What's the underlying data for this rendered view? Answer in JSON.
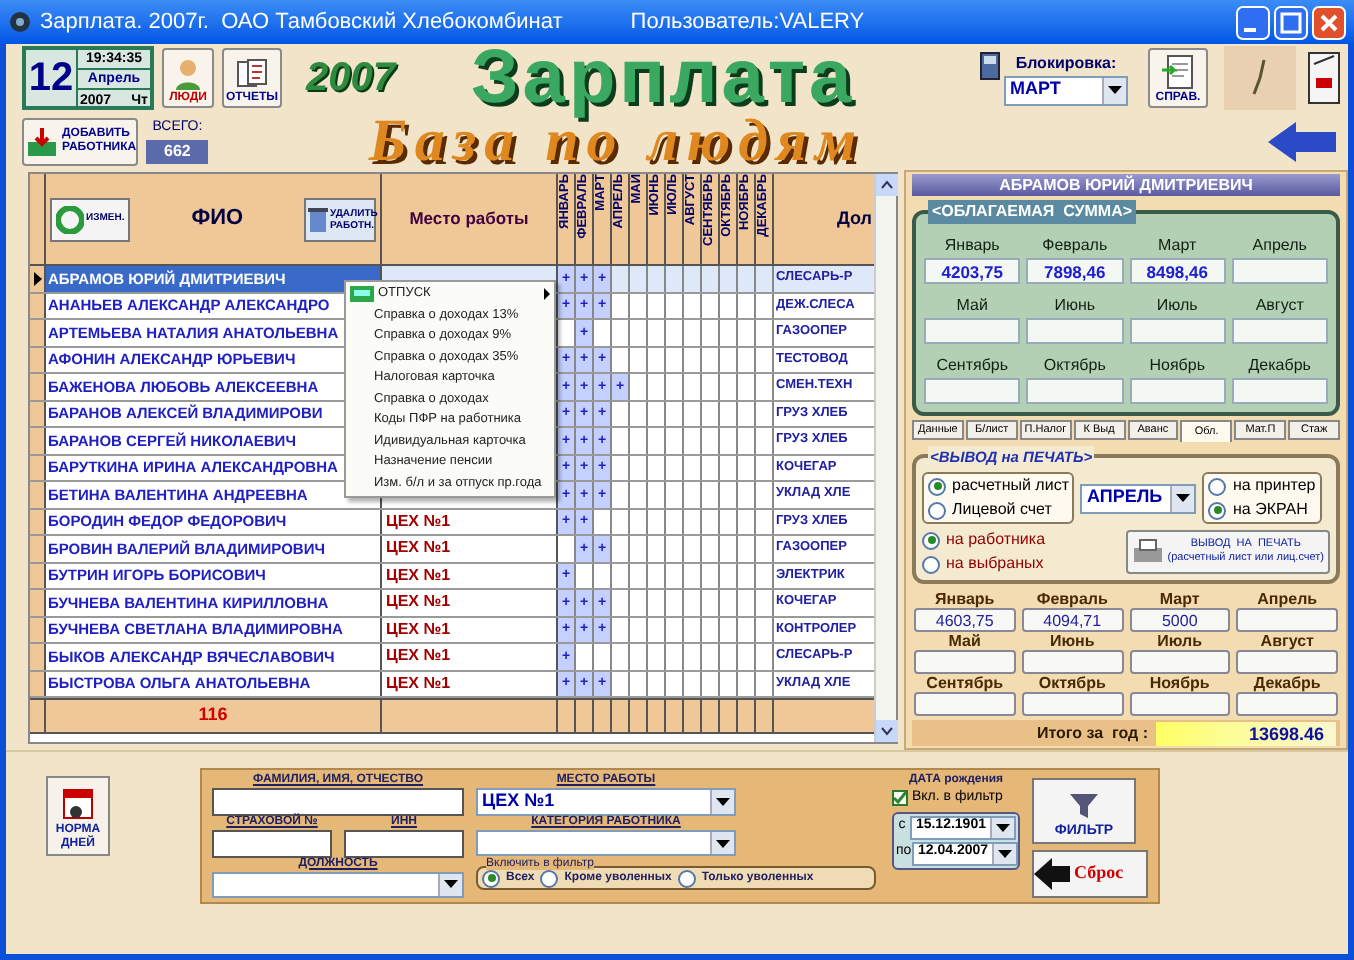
{
  "window": {
    "title": "Зарплата. 2007г.  ОАО Тамбовский Хлебокомбинат",
    "user": "Пользователь:VALERY"
  },
  "toolbar": {
    "date": {
      "day": "12",
      "time": "19:34:35",
      "month": "Апрель",
      "year": "2007",
      "weekday": "Чт"
    },
    "people_button": "ЛЮДИ",
    "reports_button": "ОТЧЕТЫ",
    "year": "2007",
    "title": "Зарплата",
    "subtitle": "База по людям",
    "lock": {
      "label": "Блокировка:",
      "value": "МАРТ"
    },
    "reference_button": "СПРАВ.",
    "add_button": "ДОБАВИТЬ РАБОТНИКА",
    "total": {
      "label": "ВСЕГО:",
      "value": "662"
    }
  },
  "table": {
    "edit_button": "ИЗМЕН.",
    "fio_header": "ФИО",
    "delete_button": "УДАЛИТЬ РАБОТН.",
    "place_header": "Место работы",
    "months": [
      "ЯНВАРЬ",
      "ФЕВРАЛЬ",
      "МАРТ",
      "АПРЕЛЬ",
      "МАЙ",
      "ИЮНЬ",
      "ИЮЛЬ",
      "АВГУСТ",
      "СЕНТЯБРЬ",
      "ОКТЯБРЬ",
      "НОЯБРЬ",
      "ДЕКАБРЬ"
    ],
    "position_header": "Дол",
    "rows": [
      {
        "name": "АБРАМОВ ЮРИЙ ДМИТРИЕВИЧ",
        "months": [
          {
            "checked": true,
            "mark": "+"
          },
          {
            "checked": true,
            "mark": "+"
          },
          {
            "checked": true,
            "mark": "+"
          },
          {
            "checked": false
          },
          {
            "checked": false
          },
          {
            "checked": false
          },
          {
            "checked": false
          },
          {
            "checked": false
          },
          {
            "checked": false
          },
          {
            "checked": false
          },
          {
            "checked": false
          },
          {
            "checked": false
          }
        ],
        "position": "СЛЕСАРЬ-Р",
        "selected": true
      },
      {
        "name": "АНАНЬЕВ АЛЕКСАНДР АЛЕКСАНДРО",
        "months": [
          {
            "checked": true,
            "mark": "+"
          },
          {
            "checked": true,
            "mark": "+"
          },
          {
            "checked": true,
            "mark": "+"
          },
          {
            "checked": false
          },
          {
            "checked": false
          },
          {
            "checked": false
          },
          {
            "checked": false
          },
          {
            "checked": false
          },
          {
            "checked": false
          },
          {
            "checked": false
          },
          {
            "checked": false
          },
          {
            "checked": false
          }
        ],
        "position": "ДЕЖ.СЛЕСА",
        "selected": false
      },
      {
        "name": "АРТЕМЬЕВА НАТАЛИЯ АНАТОЛЬЕВНА",
        "months": [
          {
            "checked": false
          },
          {
            "checked": true,
            "mark": "+"
          },
          {
            "checked": false
          },
          {
            "checked": false
          },
          {
            "checked": false
          },
          {
            "checked": false
          },
          {
            "checked": false
          },
          {
            "checked": false
          },
          {
            "checked": false
          },
          {
            "checked": false
          },
          {
            "checked": false
          },
          {
            "checked": false
          }
        ],
        "position": "ГАЗООПЕР",
        "selected": false
      },
      {
        "name": "АФОНИН АЛЕКСАНДР ЮРЬЕВИЧ",
        "months": [
          {
            "checked": true,
            "mark": "+"
          },
          {
            "checked": true,
            "mark": "+"
          },
          {
            "checked": true,
            "mark": "+"
          },
          {
            "checked": false
          },
          {
            "checked": false
          },
          {
            "checked": false
          },
          {
            "checked": false
          },
          {
            "checked": false
          },
          {
            "checked": false
          },
          {
            "checked": false
          },
          {
            "checked": false
          },
          {
            "checked": false
          }
        ],
        "position": "ТЕСТОВОД",
        "selected": false
      },
      {
        "name": "БАЖЕНОВА ЛЮБОВЬ АЛЕКСЕЕВНА",
        "months": [
          {
            "checked": true,
            "mark": "+"
          },
          {
            "checked": true,
            "mark": "+"
          },
          {
            "checked": true,
            "mark": "+"
          },
          {
            "checked": true,
            "mark": "+"
          },
          {
            "checked": false
          },
          {
            "checked": false
          },
          {
            "checked": false
          },
          {
            "checked": false
          },
          {
            "checked": false
          },
          {
            "checked": false
          },
          {
            "checked": false
          },
          {
            "checked": false
          }
        ],
        "position": "СМЕН.ТЕХН",
        "selected": false
      },
      {
        "name": "БАРАНОВ АЛЕКСЕЙ ВЛАДИМИРОВИ",
        "months": [
          {
            "checked": true,
            "mark": "+"
          },
          {
            "checked": true,
            "mark": "+"
          },
          {
            "checked": true,
            "mark": "+"
          },
          {
            "checked": false
          },
          {
            "checked": false
          },
          {
            "checked": false
          },
          {
            "checked": false
          },
          {
            "checked": false
          },
          {
            "checked": false
          },
          {
            "checked": false
          },
          {
            "checked": false
          },
          {
            "checked": false
          }
        ],
        "position": "ГРУЗ ХЛЕБ",
        "selected": false
      },
      {
        "name": "БАРАНОВ СЕРГЕЙ НИКОЛАЕВИЧ",
        "months": [
          {
            "checked": true,
            "mark": "+"
          },
          {
            "checked": true,
            "mark": "+"
          },
          {
            "checked": true,
            "mark": "+"
          },
          {
            "checked": false
          },
          {
            "checked": false
          },
          {
            "checked": false
          },
          {
            "checked": false
          },
          {
            "checked": false
          },
          {
            "checked": false
          },
          {
            "checked": false
          },
          {
            "checked": false
          },
          {
            "checked": false
          }
        ],
        "position": "ГРУЗ ХЛЕБ",
        "selected": false
      },
      {
        "name": "БАРУТКИНА ИРИНА АЛЕКСАНДРОВНА",
        "months": [
          {
            "checked": true,
            "mark": "+"
          },
          {
            "checked": true,
            "mark": "+"
          },
          {
            "checked": true,
            "mark": "+"
          },
          {
            "checked": false
          },
          {
            "checked": false
          },
          {
            "checked": false
          },
          {
            "checked": false
          },
          {
            "checked": false
          },
          {
            "checked": false
          },
          {
            "checked": false
          },
          {
            "checked": false
          },
          {
            "checked": false
          }
        ],
        "position": "КОЧЕГАР",
        "selected": false
      },
      {
        "name": "БЕТИНА ВАЛЕНТИНА АНДРЕЕВНА",
        "months": [
          {
            "checked": true,
            "mark": "+"
          },
          {
            "checked": true,
            "mark": "+"
          },
          {
            "checked": true,
            "mark": "+"
          },
          {
            "checked": false
          },
          {
            "checked": false
          },
          {
            "checked": false
          },
          {
            "checked": false
          },
          {
            "checked": false
          },
          {
            "checked": false
          },
          {
            "checked": false
          },
          {
            "checked": false
          },
          {
            "checked": false
          }
        ],
        "position": "УКЛАД ХЛЕ",
        "selected": false
      },
      {
        "name": "БОРОДИН ФЕДОР ФЕДОРОВИЧ",
        "place": "ЦЕХ №1",
        "months": [
          {
            "checked": true,
            "mark": "+"
          },
          {
            "checked": true,
            "mark": "+"
          },
          {
            "checked": false
          },
          {
            "checked": false
          },
          {
            "checked": false
          },
          {
            "checked": false
          },
          {
            "checked": false
          },
          {
            "checked": false
          },
          {
            "checked": false
          },
          {
            "checked": false
          },
          {
            "checked": false
          },
          {
            "checked": false
          }
        ],
        "position": "ГРУЗ ХЛЕБ",
        "selected": false
      },
      {
        "name": "БРОВИН ВАЛЕРИЙ ВЛАДИМИРОВИЧ",
        "place": "ЦЕХ №1",
        "months": [
          {
            "checked": false
          },
          {
            "checked": true,
            "mark": "+"
          },
          {
            "checked": true,
            "mark": "+"
          },
          {
            "checked": false
          },
          {
            "checked": false
          },
          {
            "checked": false
          },
          {
            "checked": false
          },
          {
            "checked": false
          },
          {
            "checked": false
          },
          {
            "checked": false
          },
          {
            "checked": false
          },
          {
            "checked": false
          }
        ],
        "position": "ГАЗООПЕР",
        "selected": false
      },
      {
        "name": "БУТРИН ИГОРЬ БОРИСОВИЧ",
        "place": "ЦЕХ №1",
        "months": [
          {
            "checked": true,
            "mark": "+"
          },
          {
            "checked": false
          },
          {
            "checked": false
          },
          {
            "checked": false
          },
          {
            "checked": false
          },
          {
            "checked": false
          },
          {
            "checked": false
          },
          {
            "checked": false
          },
          {
            "checked": false
          },
          {
            "checked": false
          },
          {
            "checked": false
          },
          {
            "checked": false
          }
        ],
        "position": "ЭЛЕКТРИК",
        "selected": false
      },
      {
        "name": "БУЧНЕВА ВАЛЕНТИНА КИРИЛЛОВНА",
        "place": "ЦЕХ №1",
        "months": [
          {
            "checked": true,
            "mark": "+"
          },
          {
            "checked": true,
            "mark": "+"
          },
          {
            "checked": true,
            "mark": "+"
          },
          {
            "checked": false
          },
          {
            "checked": false
          },
          {
            "checked": false
          },
          {
            "checked": false
          },
          {
            "checked": false
          },
          {
            "checked": false
          },
          {
            "checked": false
          },
          {
            "checked": false
          },
          {
            "checked": false
          }
        ],
        "position": "КОЧЕГАР",
        "selected": false
      },
      {
        "name": "БУЧНЕВА СВЕТЛАНА ВЛАДИМИРОВНА",
        "place": "ЦЕХ №1",
        "months": [
          {
            "checked": true,
            "mark": "+"
          },
          {
            "checked": true,
            "mark": "+"
          },
          {
            "checked": true,
            "mark": "+"
          },
          {
            "checked": false
          },
          {
            "checked": false
          },
          {
            "checked": false
          },
          {
            "checked": false
          },
          {
            "checked": false
          },
          {
            "checked": false
          },
          {
            "checked": false
          },
          {
            "checked": false
          },
          {
            "checked": false
          }
        ],
        "position": "КОНТРОЛЕР",
        "selected": false
      },
      {
        "name": "БЫКОВ АЛЕКСАНДР ВЯЧЕСЛАВОВИЧ",
        "place": "ЦЕХ №1",
        "months": [
          {
            "checked": true,
            "mark": "+"
          },
          {
            "checked": false
          },
          {
            "checked": false
          },
          {
            "checked": false
          },
          {
            "checked": false
          },
          {
            "checked": false
          },
          {
            "checked": false
          },
          {
            "checked": false
          },
          {
            "checked": false
          },
          {
            "checked": false
          },
          {
            "checked": false
          },
          {
            "checked": false
          }
        ],
        "position": "СЛЕСАРЬ-Р",
        "selected": false
      },
      {
        "name": "БЫСТРОВА ОЛЬГА АНАТОЛЬЕВНА",
        "place": "ЦЕХ №1",
        "months": [
          {
            "checked": true,
            "mark": "+"
          },
          {
            "checked": true,
            "mark": "+"
          },
          {
            "checked": true,
            "mark": "+"
          },
          {
            "checked": false
          },
          {
            "checked": false
          },
          {
            "checked": false
          },
          {
            "checked": false
          },
          {
            "checked": false
          },
          {
            "checked": false
          },
          {
            "checked": false
          },
          {
            "checked": false
          },
          {
            "checked": false
          }
        ],
        "position": "УКЛАД ХЛЕ",
        "selected": false
      }
    ],
    "footer_count": "116"
  },
  "context_menu": [
    {
      "label": "ОТПУСК",
      "kind": "submenu"
    },
    {
      "label": "Справка о доходах 13%",
      "kind": "plain"
    },
    {
      "label": "Справка о доходах 9%",
      "kind": "plain"
    },
    {
      "label": "Справка о доходах 35%",
      "kind": "plain"
    },
    {
      "label": "Налоговая карточка",
      "kind": "plain"
    },
    {
      "label": "Справка о доходах",
      "kind": "plain"
    },
    {
      "label": "Коды ПФР на работника",
      "kind": "plain"
    },
    {
      "label": "Идивидуальная карточка",
      "kind": "plain"
    },
    {
      "label": "Назначение пенсии",
      "kind": "plain"
    },
    {
      "label": "Изм. б/л и за отпуск пр.года",
      "kind": "plain"
    }
  ],
  "employee": {
    "name": "АБРАМОВ ЮРИЙ ДМИТРИЕВИЧ",
    "taxable": {
      "title": "<ОБЛАГАЕМАЯ  СУММА>",
      "months": [
        {
          "label": "Январь",
          "value": "4203,75"
        },
        {
          "label": "Февраль",
          "value": "7898,46"
        },
        {
          "label": "Март",
          "value": "8498,46"
        },
        {
          "label": "Апрель"
        },
        {
          "label": "Май"
        },
        {
          "label": "Июнь"
        },
        {
          "label": "Июль"
        },
        {
          "label": "Август"
        },
        {
          "label": "Сентябрь"
        },
        {
          "label": "Октябрь"
        },
        {
          "label": "Ноябрь"
        },
        {
          "label": "Декабрь"
        }
      ]
    },
    "tabs": [
      {
        "label": "Данные",
        "selected": false
      },
      {
        "label": "Б/лист",
        "selected": false
      },
      {
        "label": "П.Налог",
        "selected": false
      },
      {
        "label": "К Выд",
        "selected": false
      },
      {
        "label": "Аванс",
        "selected": false
      },
      {
        "label": "Обл.",
        "selected": true
      },
      {
        "label": "Мат.П",
        "selected": false
      },
      {
        "label": "Стаж",
        "selected": false
      }
    ],
    "print": {
      "title": "<ВЫВОД на ПЕЧАТЬ>",
      "documents": [
        {
          "label": "расчетный лист",
          "selected": true
        },
        {
          "label": "Лицевой счет",
          "selected": false
        }
      ],
      "month": "АПРЕЛЬ",
      "outputs": [
        {
          "label": "на принтер",
          "selected": false
        },
        {
          "label": "на ЭКРАН",
          "selected": true
        }
      ],
      "targets": [
        {
          "label": "на работника",
          "selected": true
        },
        {
          "label": "на выбраных",
          "selected": false
        }
      ],
      "button": {
        "line1": "ВЫВОД  НА  ПЕЧАТЬ",
        "line2": "(расчетный лист или лиц.счет)"
      }
    },
    "paid": [
      {
        "label": "Январь",
        "value": "4603,75"
      },
      {
        "label": "Февраль",
        "value": "4094,71"
      },
      {
        "label": "Март",
        "value": "5000"
      },
      {
        "label": "Апрель"
      },
      {
        "label": "Май"
      },
      {
        "label": "Июнь"
      },
      {
        "label": "Июль"
      },
      {
        "label": "Август"
      },
      {
        "label": "Сентябрь"
      },
      {
        "label": "Октябрь"
      },
      {
        "label": "Ноябрь"
      },
      {
        "label": "Декабрь"
      }
    ],
    "total": {
      "label": "Итого за  год :",
      "value": "13698.46"
    }
  },
  "filter": {
    "norm_button": "НОРМА ДНЕЙ",
    "fio_label": "ФАМИЛИЯ, ИМЯ, ОТЧЕСТВО",
    "insurance_label": "СТРАХОВОЙ №",
    "inn_label": "ИНН",
    "position_label": "ДОЛЖНОСТЬ",
    "place_label": "МЕСТО РАБОТЫ",
    "place_value": "ЦЕХ №1",
    "category_label": "КАТЕГОРИЯ  РАБОТНИКА",
    "include_title": "Включить в фильтр",
    "include": [
      {
        "label": "Всех",
        "selected": true
      },
      {
        "label": "Кроме уволенных",
        "selected": false
      },
      {
        "label": "Только уволенных",
        "selected": false
      }
    ],
    "birth_label": "ДАТА рождения",
    "birth_checkbox": {
      "label": "Вкл. в фильтр",
      "checked": true
    },
    "from_label": "с",
    "from": "15.12.1901",
    "to_label": "по",
    "to": "12.04.2007",
    "filter_button": "ФИЛЬТР",
    "reset_button": "Сброс"
  }
}
